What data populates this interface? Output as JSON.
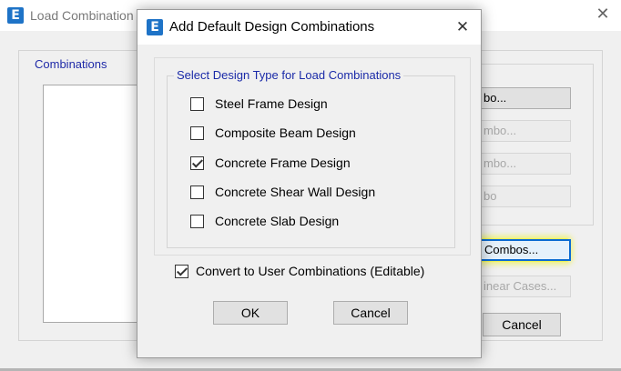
{
  "background_window": {
    "title": "Load Combination",
    "close_glyph": "✕",
    "group_label": "Combinations",
    "buttons": [
      {
        "label": "bo...",
        "enabled": true
      },
      {
        "label": "mbo...",
        "enabled": false
      },
      {
        "label": "mbo...",
        "enabled": false
      },
      {
        "label": "bo",
        "enabled": false
      },
      {
        "label": "Combos...",
        "enabled": true,
        "focused": true
      },
      {
        "label": "inear Cases...",
        "enabled": false
      }
    ],
    "cancel_label": "Cancel",
    "highlight_color": "#edf228"
  },
  "dialog": {
    "app_icon_letter": "E",
    "title": "Add Default Design Combinations",
    "close_glyph": "✕",
    "group_label": "Select Design Type for Load Combinations",
    "design_types": [
      {
        "label": "Steel Frame Design",
        "checked": false
      },
      {
        "label": "Composite Beam Design",
        "checked": false
      },
      {
        "label": "Concrete Frame Design",
        "checked": true
      },
      {
        "label": "Concrete Shear Wall Design",
        "checked": false
      },
      {
        "label": "Concrete Slab Design",
        "checked": false
      }
    ],
    "convert_option": {
      "label": "Convert to User Combinations (Editable)",
      "checked": true
    },
    "ok_label": "OK",
    "cancel_label": "Cancel"
  },
  "colors": {
    "app_icon": "#1e73c7",
    "group_label_text": "#1a2aa8",
    "focus_border": "#0a6ad2"
  }
}
